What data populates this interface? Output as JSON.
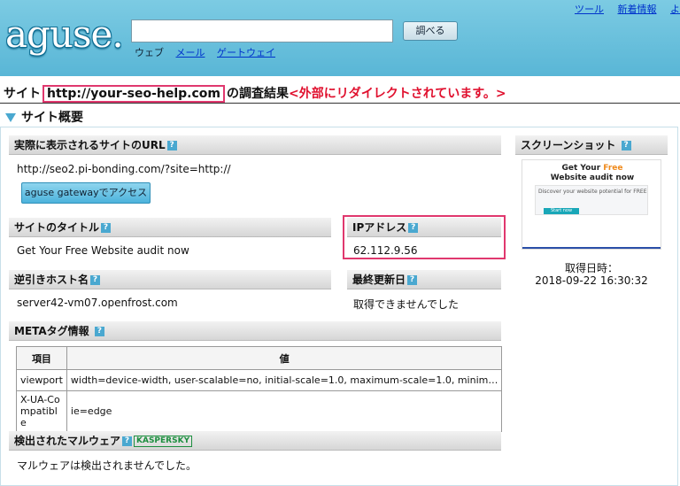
{
  "header": {
    "logo_text": "aguse.",
    "search_value": "",
    "search_button": "調べる",
    "tabs": {
      "web": "ウェブ",
      "mail": "メール",
      "gateway": "ゲートウェイ"
    },
    "top_links": {
      "tools": "ツール",
      "news": "新着情報",
      "more": "よ"
    }
  },
  "result": {
    "prefix": "サイト",
    "url": "http://your-seo-help.com",
    "middle": "の調査結果",
    "warning": "<外部にリダイレクトされています。>"
  },
  "overview": {
    "title": "サイト概要",
    "actual_url": {
      "label": "実際に表示されるサイトのURL",
      "value": "http://seo2.pi-bonding.com/?site=http://",
      "button": "aguse gatewayでアクセス"
    },
    "site_title": {
      "label": "サイトのタイトル",
      "value": "Get Your Free Website audit now"
    },
    "ip": {
      "label": "IPアドレス",
      "value": "62.112.9.56"
    },
    "reverse_host": {
      "label": "逆引きホスト名",
      "value": "server42-vm07.openfrost.com"
    },
    "last_modified": {
      "label": "最終更新日",
      "value": "取得できませんでした"
    },
    "meta": {
      "label": "METAタグ情報",
      "columns": [
        "項目",
        "値"
      ],
      "rows": [
        {
          "name": "viewport",
          "value": "width=device-width, user-scalable=no, initial-scale=1.0, maximum-scale=1.0, minim…"
        },
        {
          "name": "X-UA-Compatible",
          "value": "ie=edge"
        }
      ]
    },
    "malware": {
      "label": "検出されたマルウェア",
      "badge": "KASPERSKY",
      "value": "マルウェアは検出されませんでした。"
    },
    "screenshot": {
      "label": "スクリーンショット",
      "thumb_title_1": "Get Your ",
      "thumb_free": "Free",
      "thumb_title_2": "Website audit now",
      "thumb_sub": "Discover your website potential for FREE",
      "thumb_btn": "Start now",
      "caption_label": "取得日時：",
      "caption_date": "2018-09-22 16:30:32"
    },
    "help_glyph": "?"
  },
  "colors": {
    "header": "#5fb9d8",
    "highlight": "#e0386e",
    "warning": "#e0102e",
    "link": "#0033cc"
  }
}
